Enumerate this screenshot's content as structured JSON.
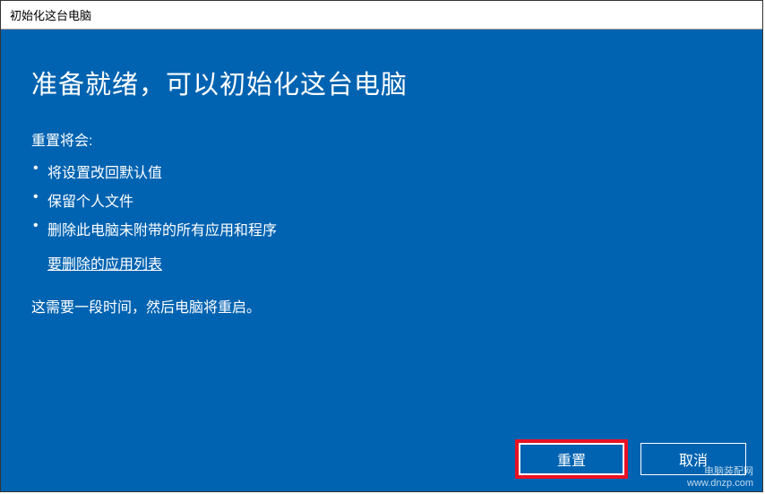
{
  "window": {
    "title": "初始化这台电脑"
  },
  "main": {
    "heading": "准备就绪，可以初始化这台电脑",
    "subheading": "重置将会:",
    "bullets": {
      "0": "将设置改回默认值",
      "1": "保留个人文件",
      "2": "删除此电脑未附带的所有应用和程序"
    },
    "link": "要删除的应用列表",
    "note": "这需要一段时间，然后电脑将重启。"
  },
  "buttons": {
    "reset": "重置",
    "cancel": "取消"
  },
  "watermark": {
    "line1": "电脑装配网",
    "line2": "www.dnzp.com"
  }
}
